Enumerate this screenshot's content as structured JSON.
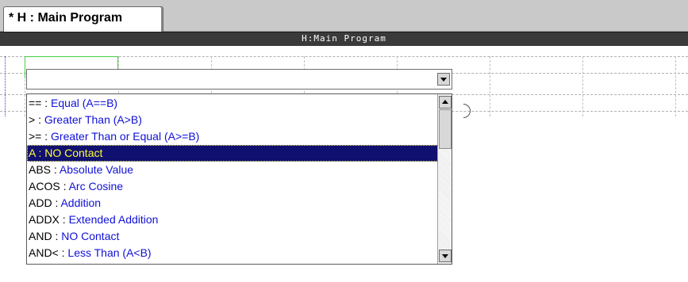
{
  "tab": {
    "label": "* H : Main Program"
  },
  "title_bar": {
    "text": "H:Main Program"
  },
  "combo": {
    "value": ""
  },
  "list": {
    "items": [
      {
        "code": "== : ",
        "desc": "Equal (A==B)",
        "selected": false
      },
      {
        "code": "> : ",
        "desc": "Greater Than (A>B)",
        "selected": false
      },
      {
        "code": ">= : ",
        "desc": "Greater Than or Equal (A>=B)",
        "selected": false
      },
      {
        "code": "A : ",
        "desc": "NO Contact",
        "selected": true
      },
      {
        "code": "ABS : ",
        "desc": "Absolute Value",
        "selected": false
      },
      {
        "code": "ACOS : ",
        "desc": "Arc Cosine",
        "selected": false
      },
      {
        "code": "ADD : ",
        "desc": "Addition",
        "selected": false
      },
      {
        "code": "ADDX : ",
        "desc": "Extended Addition",
        "selected": false
      },
      {
        "code": "AND : ",
        "desc": "NO Contact",
        "selected": false
      },
      {
        "code": "AND< : ",
        "desc": "Less Than (A<B)",
        "selected": false
      }
    ]
  },
  "colors": {
    "selection_bg": "#101070",
    "selection_text": "#ffff33",
    "description_text": "#1010d8",
    "cursor_outline": "#44d044"
  },
  "icons": {
    "combo_arrow": "chevron-down-icon",
    "scroll_up": "arrow-up-icon",
    "scroll_down": "arrow-down-icon"
  }
}
